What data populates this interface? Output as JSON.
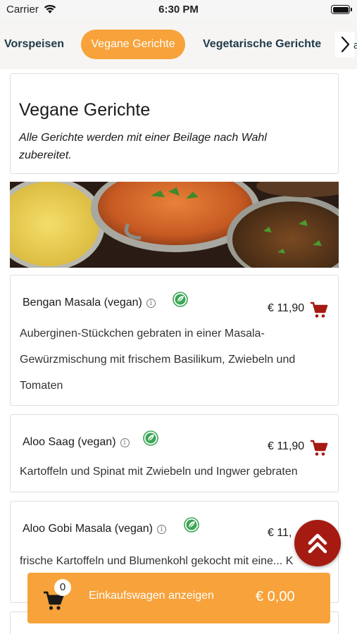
{
  "status": {
    "carrier": "Carrier",
    "time": "6:30 PM"
  },
  "tabs": [
    {
      "label": "Vorspeisen",
      "active": false
    },
    {
      "label": "Vegane Gerichte",
      "active": true
    },
    {
      "label": "Vegetarische Gerichte",
      "active": false
    }
  ],
  "tabs_clip": "a",
  "section": {
    "title": "Vegane Gerichte",
    "subtitle": "Alle Gerichte werden mit einer Beilage nach Wahl zubereitet."
  },
  "dishes": [
    {
      "name": "Bengan Masala (vegan)",
      "price": "€ 11,90",
      "description": "Auberginen-Stückchen gebraten in einer Masala-Gewürzmischung mit frischem Basilikum, Zwiebeln und Tomaten"
    },
    {
      "name": "Aloo Saag (vegan)",
      "price": "€ 11,90",
      "description": "Kartoffeln und Spinat mit Zwiebeln und Ingwer gebraten"
    },
    {
      "name": "Aloo Gobi Masala (vegan)",
      "price": "€ 11,",
      "description": "frische Kartoffeln und Blumenkohl gekocht mit eine... K"
    }
  ],
  "cart": {
    "count": "0",
    "label": "Einkaufswagen anzeigen",
    "total": "€ 0,00"
  },
  "colors": {
    "accent": "#f7a23a",
    "cart_red": "#a51b12",
    "vegan_green": "#3aa655",
    "tab_text": "#1e3a4a"
  },
  "icons": [
    "wifi-icon",
    "battery-icon",
    "chevron-right-icon",
    "info-icon",
    "vegan-leaf-icon",
    "shopping-cart-icon",
    "double-chevron-up-icon"
  ]
}
